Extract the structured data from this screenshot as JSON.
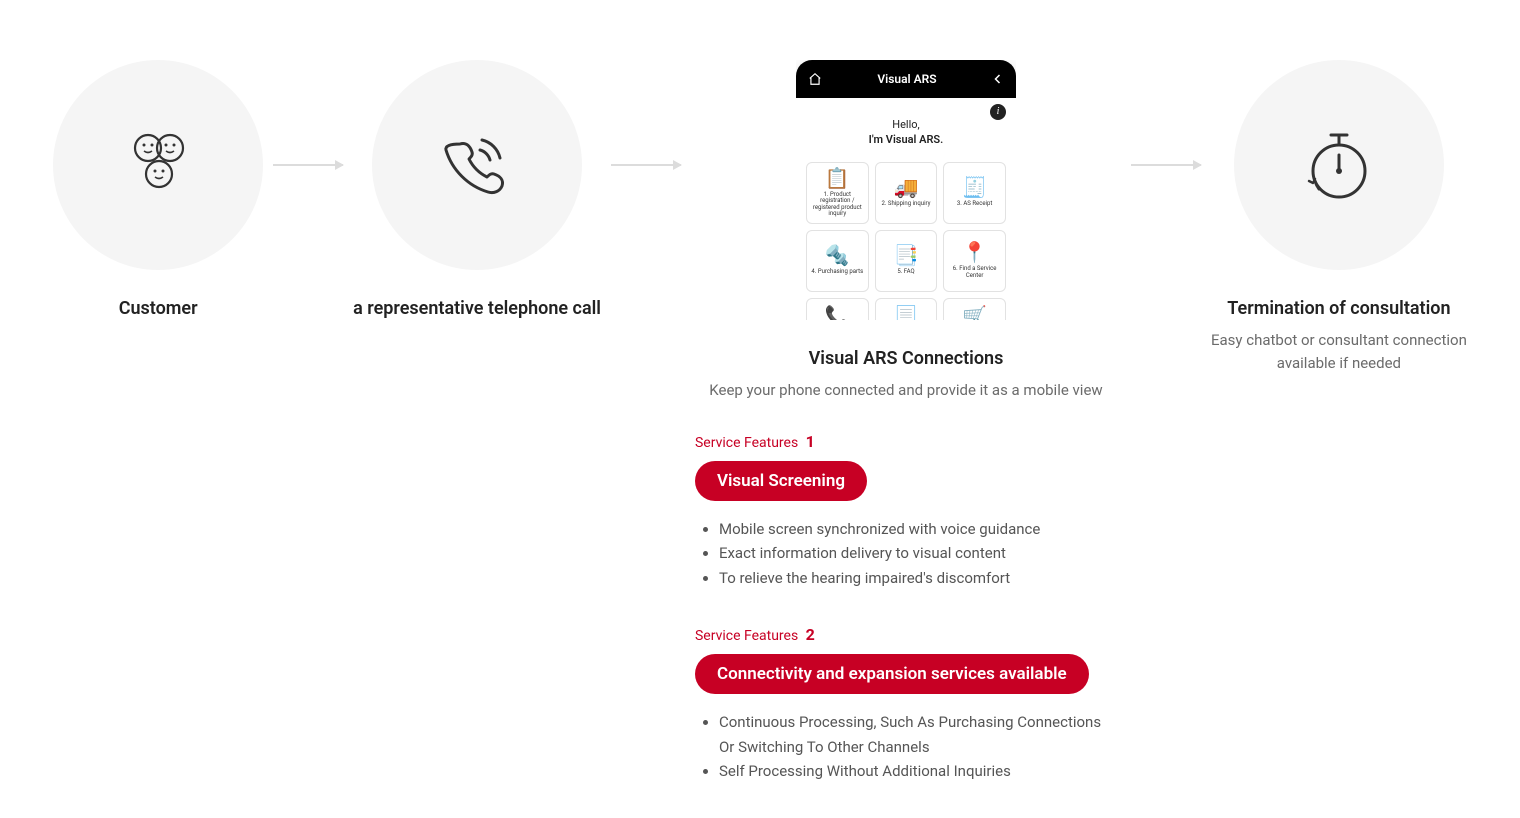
{
  "steps": {
    "s1": {
      "title": "Customer"
    },
    "s2": {
      "title": "a representative telephone call"
    },
    "s3": {
      "title": "Visual ARS Connections",
      "subtitle": "Keep your phone connected and provide it as a mobile view"
    },
    "s4": {
      "title": "Termination of consultation",
      "subtitle_line1": "Easy chatbot or consultant connection",
      "subtitle_line2": "available if needed"
    }
  },
  "phone": {
    "bar_title": "Visual ARS",
    "hello_line1": "Hello,",
    "hello_line2": "I'm Visual ARS.",
    "tiles": [
      {
        "icon": "📋",
        "label": "1. Product registration / registered product inquiry"
      },
      {
        "icon": "🚚",
        "label": "2. Shipping inquiry"
      },
      {
        "icon": "🧾",
        "label": "3. AS Receipt"
      },
      {
        "icon": "🔩",
        "label": "4. Purchasing parts"
      },
      {
        "icon": "📑",
        "label": "5. FAQ"
      },
      {
        "icon": "📍",
        "label": "6. Find a Service Center"
      },
      {
        "icon": "📞",
        "label": ""
      },
      {
        "icon": "📃",
        "label": ""
      },
      {
        "icon": "🛒",
        "label": ""
      }
    ]
  },
  "features": {
    "label": "Service Features",
    "f1": {
      "num": "1",
      "pill": "Visual Screening",
      "bullets": [
        "Mobile screen synchronized with voice guidance",
        "Exact information delivery to visual content",
        "To relieve the hearing impaired's discomfort"
      ]
    },
    "f2": {
      "num": "2",
      "pill": "Connectivity and expansion services available",
      "bullets": [
        "Continuous Processing, Such As Purchasing Connections Or Switching To Other Channels",
        "Self Processing Without Additional Inquiries"
      ]
    }
  }
}
